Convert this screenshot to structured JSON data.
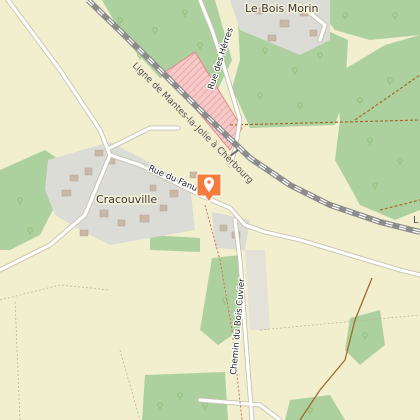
{
  "map": {
    "places": {
      "bois_morin": "Le Bois Morin",
      "cracouville": "Cracouville"
    },
    "roads": {
      "rue_herres": "Rue des Hêrres",
      "rue_fanum": "Rue du Fanum",
      "chemin_bois_cuvier": "Chemin du Bois Cuvier"
    },
    "railway": "Ligne de Mantes-la-Jolie à Cherbourg",
    "edge_label": "L",
    "marker": {
      "icon": "map-pin-icon",
      "color": "#f47c3c"
    },
    "colors": {
      "background": "#f2efcf",
      "forest": "#add19e",
      "residential": "#dcdcd6",
      "road": "#ffffff",
      "road_casing": "#c8c2b0",
      "rail": "#9a9a9a",
      "track": "#a46a2a",
      "hatched_area": "#f2b5b5"
    }
  }
}
